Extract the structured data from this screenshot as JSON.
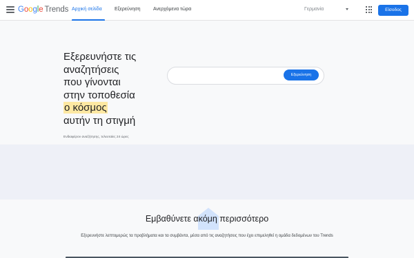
{
  "header": {
    "logo_letters": [
      "G",
      "o",
      "o",
      "g",
      "l",
      "e"
    ],
    "logo_product": "Trends",
    "tabs": [
      {
        "label": "Αρχική σελίδα",
        "active": true
      },
      {
        "label": "Εξερεύνηση",
        "active": false
      },
      {
        "label": "Ανερχόμενα τώρα",
        "active": false
      }
    ],
    "country": "Γερμανία",
    "signin_label": "Είσοδος"
  },
  "hero": {
    "title_lines": [
      "Εξερευνήστε τις",
      "αναζητήσεις",
      "που γίνονται",
      "στην τοποθεσία"
    ],
    "title_highlight": "ο κόσμος",
    "title_tail": "αυτήν τη στιγμή",
    "subtitle": "Ενδιαφέρον αναζήτησης, τελευταίες 24 ώρες",
    "search_button_label": "Εξερεύνηση"
  },
  "lower": {
    "title": "Εμβαθύνετε ακόμη περισσότερο",
    "description": "Εξερευνήστε λεπτομερώς τα προβλήματα και τα συμβάντα, μέσα από τις αναζητήσεις που έχει επιμεληθεί η ομάδα δεδομένων του Trends"
  },
  "colors": {
    "accent": "#1a73e8",
    "highlight": "#fde8a2",
    "band": "#eef0f7"
  }
}
